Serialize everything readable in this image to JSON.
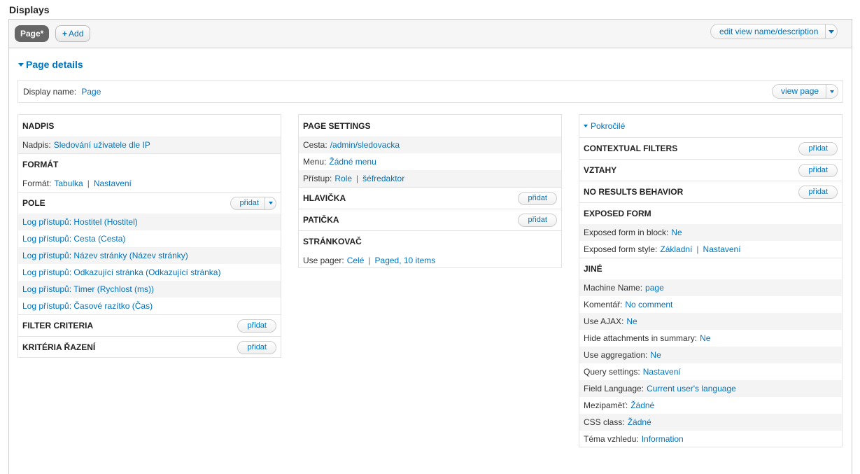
{
  "page_title": "Displays",
  "tabs": {
    "page_label": "Page*",
    "add_plus": "+",
    "add_label": "Add",
    "edit_view_label": "edit view name/description"
  },
  "details": {
    "heading": "Page details",
    "display_name_label": "Display name:",
    "display_name_value": "Page",
    "view_page_label": "view page"
  },
  "left": {
    "nadpis": {
      "heading": "NADPIS",
      "label": "Nadpis:",
      "value": "Sledování uživatele dle IP"
    },
    "format": {
      "heading": "FORMÁT",
      "label": "Formát:",
      "value": "Tabulka",
      "settings": "Nastavení"
    },
    "pole": {
      "heading": "POLE",
      "add": "přidat",
      "items": [
        "Log přístupů: Hostitel (Hostitel)",
        "Log přístupů: Cesta (Cesta)",
        "Log přístupů: Název stránky (Název stránky)",
        "Log přístupů: Odkazující stránka (Odkazující stránka)",
        "Log přístupů: Timer (Rychlost (ms))",
        "Log přístupů: Časové razítko (Čas)"
      ]
    },
    "filter": {
      "heading": "FILTER CRITERIA",
      "add": "přidat"
    },
    "sort": {
      "heading": "KRITÉRIA ŘAZENÍ",
      "add": "přidat"
    }
  },
  "middle": {
    "page_settings": {
      "heading": "PAGE SETTINGS",
      "path_label": "Cesta:",
      "path_value": "/admin/sledovacka",
      "menu_label": "Menu:",
      "menu_value": "Žádné menu",
      "access_label": "Přístup:",
      "access_value1": "Role",
      "access_value2": "šéfredaktor"
    },
    "header": {
      "heading": "HLAVIČKA",
      "add": "přidat"
    },
    "footer": {
      "heading": "PATIČKA",
      "add": "přidat"
    },
    "pager": {
      "heading": "STRÁNKOVAČ",
      "label": "Use pager:",
      "value1": "Celé",
      "value2": "Paged, 10 items"
    }
  },
  "right": {
    "advanced_label": "Pokročilé",
    "contextual": {
      "heading": "CONTEXTUAL FILTERS",
      "add": "přidat"
    },
    "relationships": {
      "heading": "VZTAHY",
      "add": "přidat"
    },
    "no_results": {
      "heading": "NO RESULTS BEHAVIOR",
      "add": "přidat"
    },
    "exposed": {
      "heading": "EXPOSED FORM",
      "block_label": "Exposed form in block:",
      "block_value": "Ne",
      "style_label": "Exposed form style:",
      "style_value": "Základní",
      "style_settings": "Nastavení"
    },
    "other": {
      "heading": "JINÉ",
      "rows": [
        {
          "label": "Machine Name:",
          "value": "page"
        },
        {
          "label": "Komentář:",
          "value": "No comment"
        },
        {
          "label": "Use AJAX:",
          "value": "Ne"
        },
        {
          "label": "Hide attachments in summary:",
          "value": "Ne"
        },
        {
          "label": "Use aggregation:",
          "value": "Ne"
        },
        {
          "label": "Query settings:",
          "value": "Nastavení"
        },
        {
          "label": "Field Language:",
          "value": "Current user's language"
        },
        {
          "label": "Mezipaměť:",
          "value": "Žádné"
        },
        {
          "label": "CSS class:",
          "value": "Žádné"
        },
        {
          "label": "Téma vzhledu:",
          "value": "Information"
        }
      ]
    }
  },
  "colors": {
    "link": "#0074bd",
    "tab_active": "#666666",
    "stripe": "#f4f4f4"
  }
}
